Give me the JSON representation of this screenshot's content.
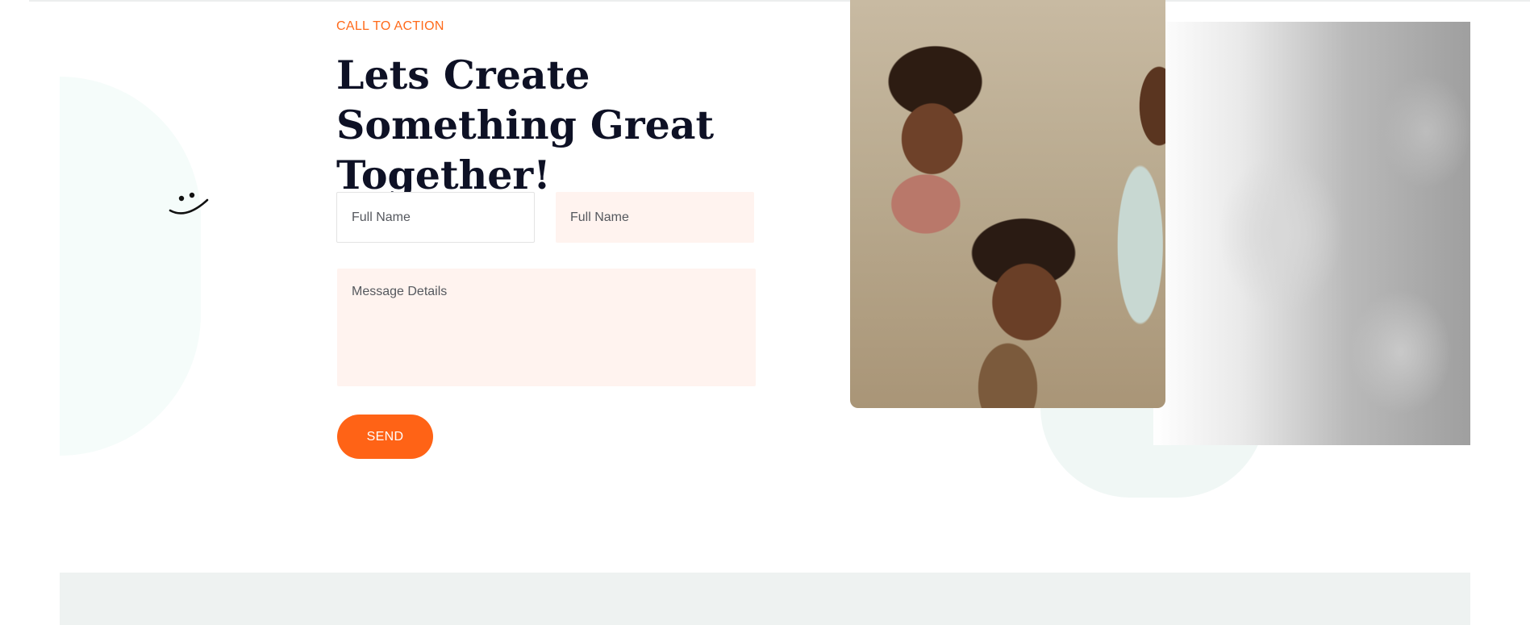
{
  "section": {
    "eyebrow": "CALL TO ACTION",
    "headline": "Lets Create Something Great Together!"
  },
  "form": {
    "name_placeholder_1": "Full Name",
    "name_placeholder_2": "Full Name",
    "message_placeholder": "Message Details",
    "send_label": "SEND"
  },
  "colors": {
    "accent": "#ff6316",
    "heading": "#0e1125",
    "field_tint": "#fff3ef",
    "footer_band": "#eef2f1"
  },
  "icons": {
    "smile": "smile-face-icon"
  }
}
